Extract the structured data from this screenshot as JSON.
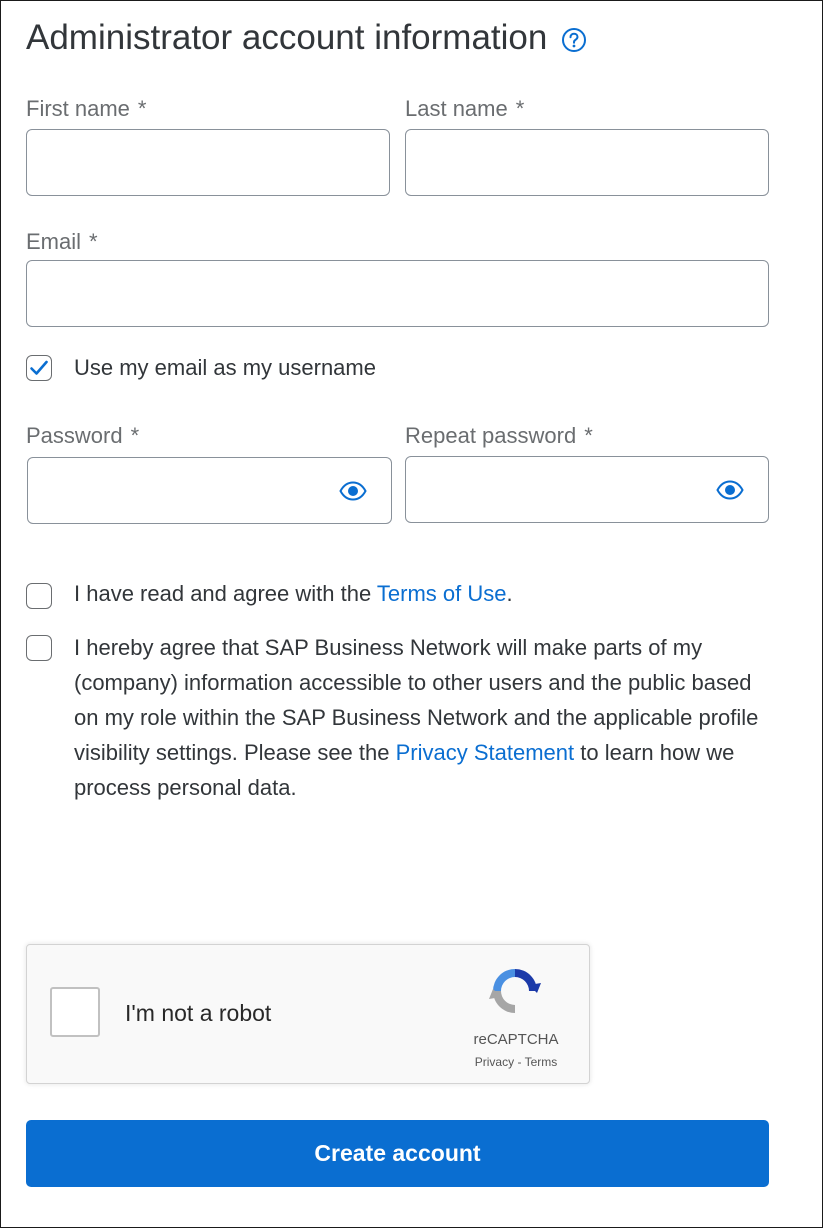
{
  "form": {
    "title": "Administrator account information",
    "required_marker": "*",
    "first_name": {
      "label": "First name",
      "value": ""
    },
    "last_name": {
      "label": "Last name",
      "value": ""
    },
    "email": {
      "label": "Email",
      "value": ""
    },
    "use_email_username": {
      "label": "Use my email as my username",
      "checked": true
    },
    "password": {
      "label": "Password",
      "value": ""
    },
    "repeat_password": {
      "label": "Repeat password",
      "value": ""
    },
    "terms": {
      "text_before": "I have read and agree with the ",
      "link_text": "Terms of Use",
      "text_after": ".",
      "checked": false
    },
    "privacy": {
      "text_before": "I hereby agree that SAP Business Network will make parts of my (company) information accessible to other users and the public based on my role within the SAP Business Network and the applicable profile visibility settings. Please see the ",
      "link_text": "Privacy Statement",
      "text_after": " to learn how we process personal data.",
      "checked": false
    }
  },
  "recaptcha": {
    "label": "I'm not a robot",
    "brand": "reCAPTCHA",
    "privacy_link": "Privacy",
    "separator": " - ",
    "terms_link": "Terms",
    "checked": false
  },
  "actions": {
    "create_label": "Create account"
  },
  "icons": {
    "help": "question-circle-icon",
    "show_password": "eye-icon",
    "checkmark": "check-icon",
    "recaptcha_logo": "recaptcha-logo-icon"
  },
  "colors": {
    "primary": "#0a6ed1",
    "link": "#0a6ed1",
    "text": "#32363a",
    "label": "#6a6d70",
    "border": "#89919a"
  }
}
